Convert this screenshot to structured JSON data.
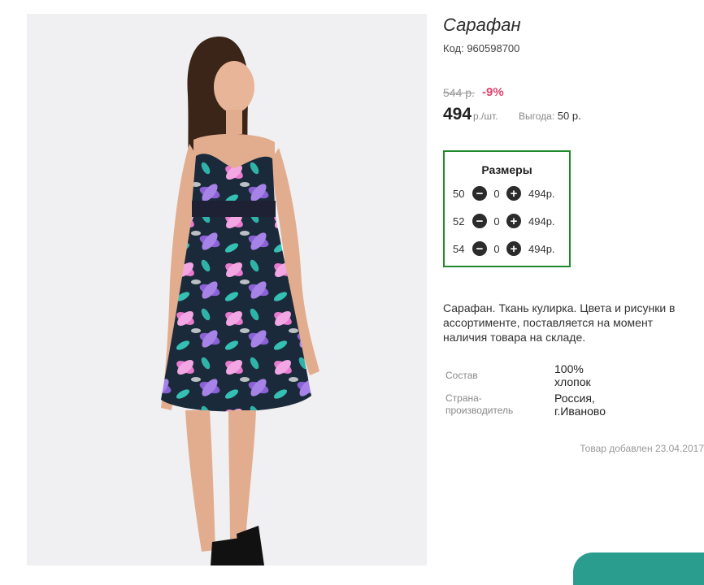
{
  "product": {
    "title": "Сарафан",
    "code": "Код: 960598700",
    "old_price": "544 р.",
    "discount": "-9%",
    "price": "494",
    "unit": "р./шт.",
    "saving_label": "Выгода:",
    "saving_value": "50 р.",
    "description": "Сарафан. Ткань кулирка. Цвета и рисунки в ассортименте, поставляется на момент наличия товара на складе.",
    "added": "Товар добавлен 23.04.2017"
  },
  "sizes": {
    "title": "Размеры",
    "rows": [
      {
        "size": "50",
        "qty": "0",
        "price": "494р."
      },
      {
        "size": "52",
        "qty": "0",
        "price": "494р."
      },
      {
        "size": "54",
        "qty": "0",
        "price": "494р."
      }
    ],
    "minus_glyph": "−",
    "plus_glyph": "+"
  },
  "specs": [
    {
      "label": "Состав",
      "value_line1": "100%",
      "value_line2": "хлопок"
    },
    {
      "label_line1": "Страна-",
      "label_line2": "производитель",
      "value_line1": "Россия,",
      "value_line2": "г.Иваново"
    }
  ],
  "colors": {
    "accent_green": "#1f8a2a",
    "discount_red": "#e0446b",
    "teal": "#2a9d8f"
  },
  "icons": [
    "minus-circle-icon",
    "plus-circle-icon"
  ]
}
